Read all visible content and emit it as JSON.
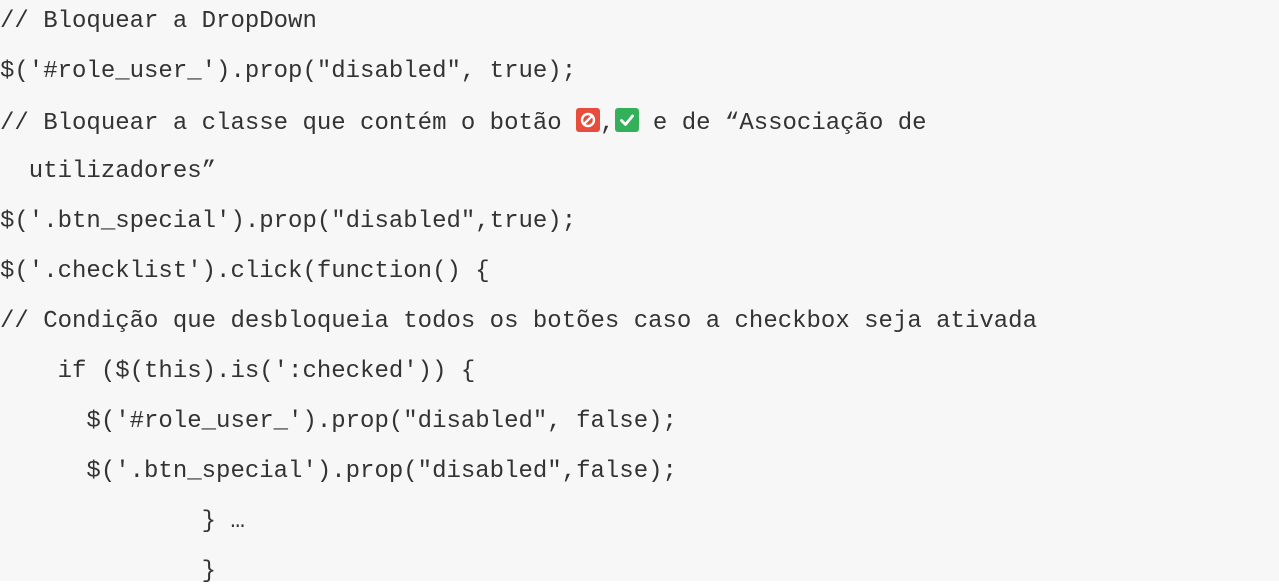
{
  "code_lines": [
    "// Bloquear a DropDown",
    "$('#role_user_').prop(\"disabled\", true);",
    "// Bloquear a classe que contém o botão ",
    ",",
    " e de “Associação de",
    "  utilizadores”",
    "$('.btn_special').prop(\"disabled\",true);",
    "$('.checklist').click(function() {",
    "// Condição que desbloqueia todos os botões caso a checkbox seja ativada",
    "    if ($(this).is(':checked')) {",
    "      $('#role_user_').prop(\"disabled\", false);",
    "      $('.btn_special').prop(\"disabled\",false);",
    "              } …",
    "              }"
  ],
  "icons": {
    "disable": "ban-icon",
    "enable": "checkmark-icon",
    "disable_color": "#e74c3c",
    "enable_color": "#34b05a"
  }
}
